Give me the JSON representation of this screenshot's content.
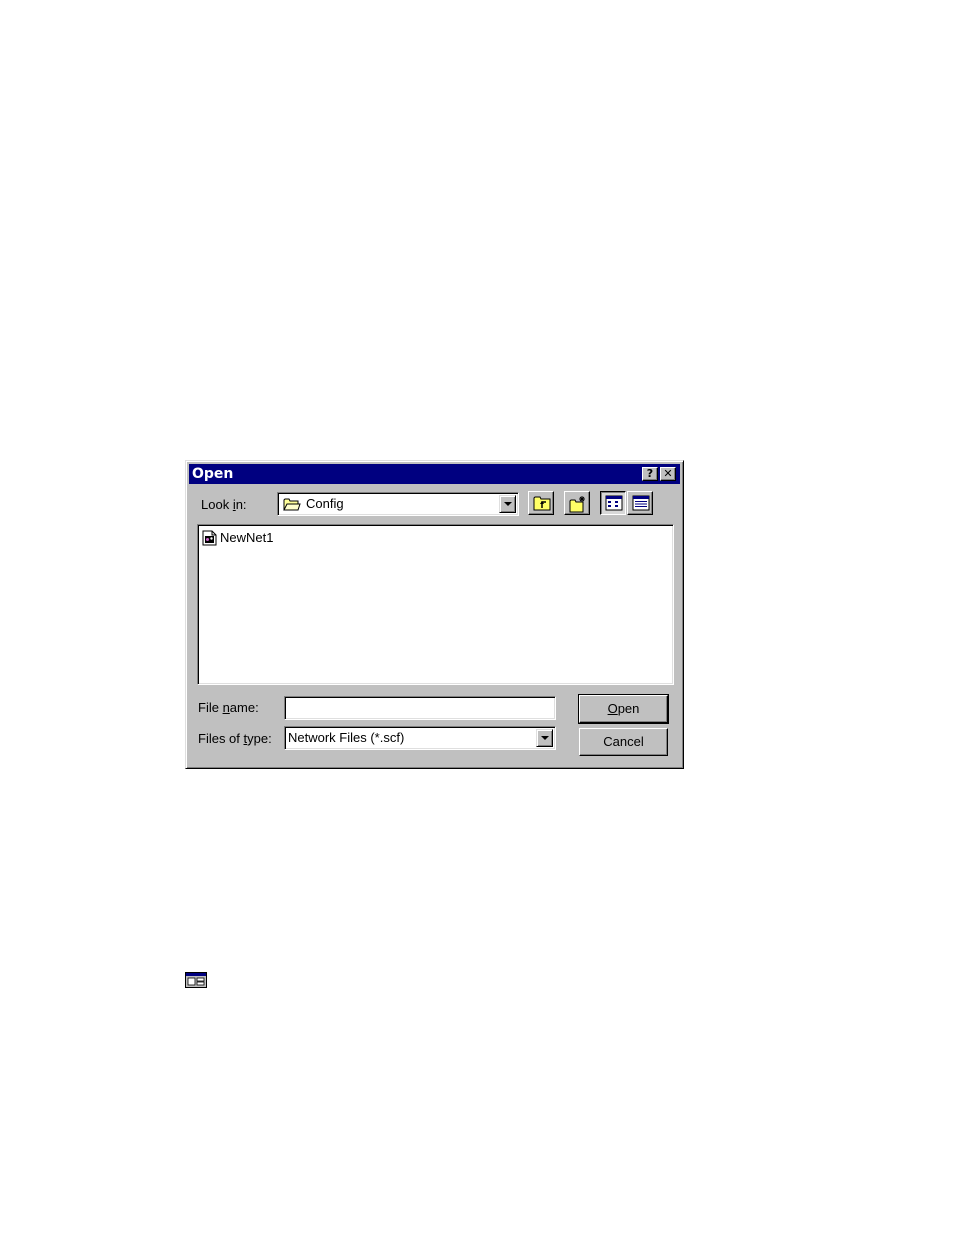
{
  "dialog": {
    "title": "Open",
    "help_button": "?",
    "close_button": "✕",
    "look_in": {
      "label_pre": "Look ",
      "label_accel": "i",
      "label_post": "n:",
      "value": "Config"
    },
    "toolbar": {
      "up_one_level": "up-folder-icon",
      "create_new_folder": "new-folder-icon",
      "list_view": "list-view-icon",
      "details_view": "details-view-icon"
    },
    "files": [
      {
        "name": "NewNet1",
        "icon": "network-file-icon"
      }
    ],
    "file_name": {
      "label_pre": "File ",
      "label_accel": "n",
      "label_post": "ame:",
      "value": ""
    },
    "files_of_type": {
      "label_pre": "Files of ",
      "label_accel": "t",
      "label_post": "ype:",
      "value": "Network Files (*.scf)"
    },
    "open_button": {
      "accel": "O",
      "rest": "pen"
    },
    "cancel_button": "Cancel"
  },
  "colors": {
    "titlebar": "#000080",
    "face": "#c0c0c0"
  }
}
